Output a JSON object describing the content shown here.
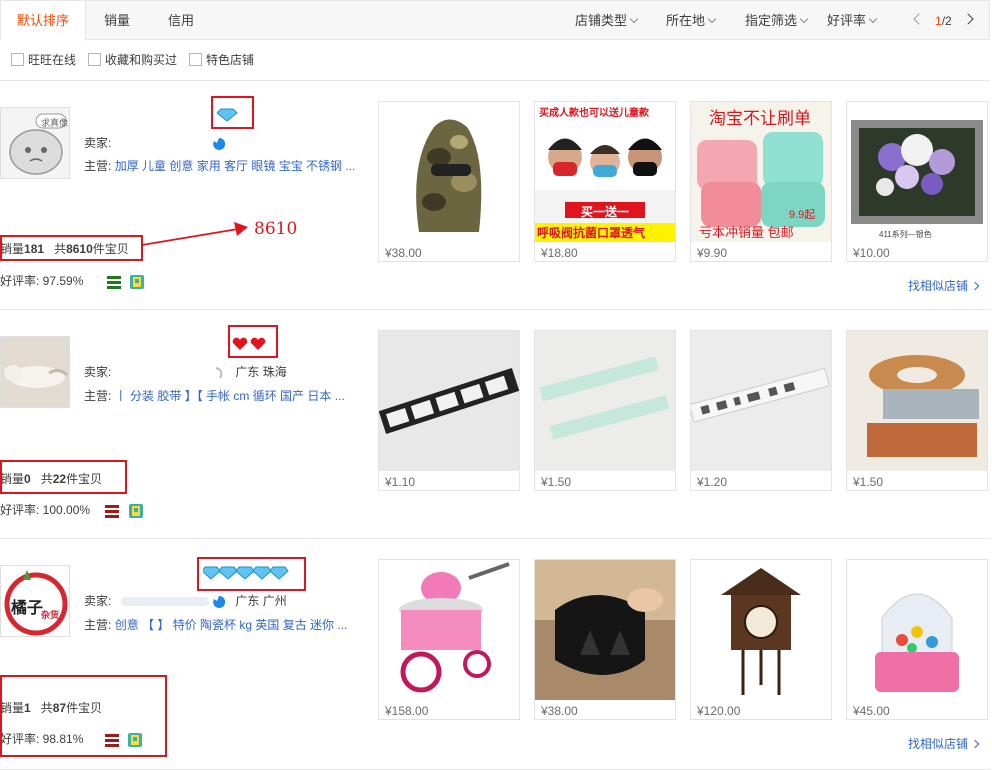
{
  "sort_tabs": [
    "默认排序",
    "销量",
    "信用"
  ],
  "filters_dropdowns": [
    "店铺类型",
    "所在地",
    "指定筛选",
    "好评率"
  ],
  "pager": {
    "current": "1",
    "total": "/2"
  },
  "checkboxes": [
    "旺旺在线",
    "收藏和购买过",
    "特色店铺"
  ],
  "annotation_value": "8610",
  "colors": {
    "accent": "#ff4400",
    "link": "#3366cc",
    "highlight": "#e1141e"
  },
  "shops": [
    {
      "logo_text": "求真像",
      "seller_label": "卖家:",
      "location": "",
      "main_label": "主营:",
      "main_cats": "加厚 儿童 创意 家用 客厅 眼镜 宝宝 不锈钢 ...",
      "sales_prefix": "销量",
      "sales_count": "181",
      "items_prefix": "共",
      "items_count": "8610",
      "items_suffix": "件宝贝",
      "rate_label": "好评率: 97.59%",
      "credit_icons": "diamond",
      "credit_count": 1,
      "similar_label": "找相似店铺",
      "products": [
        {
          "price": "¥38.00",
          "icon": "camo-balaclava"
        },
        {
          "price": "¥18.80",
          "icon": "masks-ad",
          "caption_top": "买成人款也可以送儿童款",
          "caption_mid": "买一送一",
          "caption_bot": "呼吸阀抗菌口罩透气"
        },
        {
          "price": "¥9.90",
          "icon": "cushions",
          "caption_top": "淘宝不让刷单",
          "caption_mid": "9.9起",
          "caption_bot": "亏本冲销量 包邮"
        },
        {
          "price": "¥10.00",
          "icon": "flower-painting",
          "caption_bot": "411系列—银色"
        }
      ]
    },
    {
      "logo_text": "",
      "seller_label": "卖家:",
      "location": "广东 珠海",
      "main_label": "主营:",
      "main_cats": "丨 分装 胶带 】【 手帐 cm 循环 国产 日本 ...",
      "sales_prefix": "销量",
      "sales_count": "0",
      "items_prefix": "共",
      "items_count": "22",
      "items_suffix": "件宝贝",
      "rate_label": "好评率: 100.00%",
      "credit_icons": "heart",
      "credit_count": 2,
      "similar_label": "",
      "products": [
        {
          "price": "¥1.10",
          "icon": "film-tape"
        },
        {
          "price": "¥1.50",
          "icon": "mint-tape"
        },
        {
          "price": "¥1.20",
          "icon": "text-tape"
        },
        {
          "price": "¥1.50",
          "icon": "tape-rolls"
        }
      ]
    },
    {
      "logo_text": "橘子",
      "logo_sub": "杂货",
      "seller_label": "卖家:",
      "location": "广东 广州",
      "main_label": "主营:",
      "main_cats": "创意 【 】 特价 陶瓷杯 kg 英国 复古 迷你 ...",
      "sales_prefix": "销量",
      "sales_count": "1",
      "items_prefix": "共",
      "items_count": "87",
      "items_suffix": "件宝贝",
      "rate_label": "好评率: 98.81%",
      "credit_icons": "diamond",
      "credit_count": 5,
      "similar_label": "找相似店铺",
      "products": [
        {
          "price": "¥158.00",
          "icon": "cotton-candy-machine"
        },
        {
          "price": "¥38.00",
          "icon": "helmet-mug"
        },
        {
          "price": "¥120.00",
          "icon": "cuckoo-clock"
        },
        {
          "price": "¥45.00",
          "icon": "candy-dispenser"
        }
      ]
    }
  ]
}
